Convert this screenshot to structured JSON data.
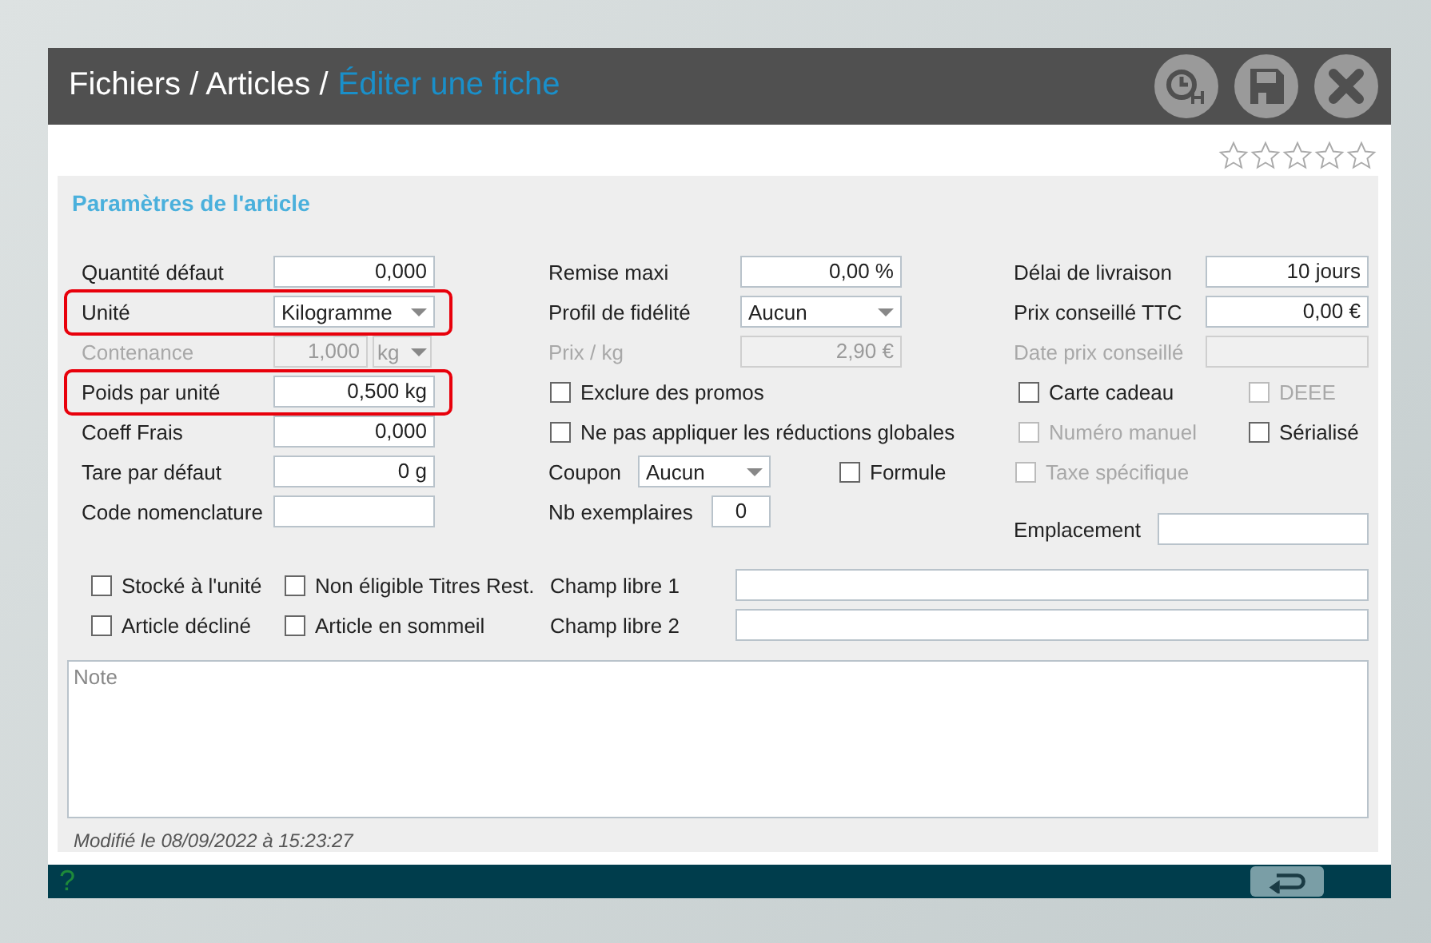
{
  "header": {
    "path": "Fichiers / Articles /",
    "current": "Éditer une fiche"
  },
  "stars": 0,
  "panel_title": "Paramètres de l'article",
  "columns": [
    {
      "rows": [
        {
          "cells": [
            {
              "kind": "field",
              "label": "Quantité défaut",
              "value": "0,000"
            }
          ]
        },
        {
          "cells": [
            {
              "kind": "select",
              "label": "Unité",
              "value": "Kilogramme",
              "highlighted": true
            }
          ]
        },
        {
          "cells": [
            {
              "kind": "field-unit",
              "label": "Contenance",
              "value": "1,000",
              "unit": "kg",
              "disabled": true
            }
          ]
        },
        {
          "cells": [
            {
              "kind": "field",
              "label": "Poids par unité",
              "value": "0,500 kg",
              "highlighted": true
            }
          ]
        },
        {
          "cells": [
            {
              "kind": "field",
              "label": "Coeff Frais",
              "value": "0,000"
            }
          ]
        },
        {
          "cells": [
            {
              "kind": "field",
              "label": "Tare par défaut",
              "value": "0 g"
            }
          ]
        },
        {
          "cells": [
            {
              "kind": "field",
              "label": "Code nomenclature"
            }
          ]
        }
      ]
    },
    {
      "rows": [
        {
          "cells": [
            {
              "kind": "field",
              "label": "Remise maxi",
              "value": "0,00 %"
            }
          ]
        },
        {
          "cells": [
            {
              "kind": "select",
              "label": "Profil de fidélité",
              "value": "Aucun"
            }
          ]
        },
        {
          "cells": [
            {
              "kind": "field",
              "label": "Prix / kg",
              "value": "2,90 €",
              "disabled": true
            }
          ]
        },
        {
          "cells": [
            {
              "kind": "checkbox",
              "label": "Exclure des promos",
              "checked": false
            }
          ]
        },
        {
          "cells": [
            {
              "kind": "checkbox",
              "label": "Ne pas appliquer les réductions globales",
              "checked": false
            }
          ]
        },
        {
          "cells": [
            {
              "kind": "short-select",
              "label": "Coupon",
              "value": "Aucun"
            },
            {
              "kind": "checkbox",
              "label": "Formule",
              "checked": false
            }
          ]
        },
        {
          "cells": [
            {
              "kind": "short-field",
              "label": "Nb exemplaires",
              "value": "0"
            }
          ]
        }
      ]
    },
    {
      "rows": [
        {
          "cells": [
            {
              "kind": "field",
              "label": "Délai de livraison",
              "value": "10 jours"
            }
          ]
        },
        {
          "cells": [
            {
              "kind": "field",
              "label": "Prix conseillé TTC",
              "value": "0,00 €"
            }
          ]
        },
        {
          "cells": [
            {
              "kind": "field",
              "label": "Date prix conseillé",
              "disabled": true
            }
          ]
        },
        {
          "cells": [
            {
              "kind": "checkbox",
              "label": "Carte cadeau",
              "checked": false
            },
            {
              "kind": "checkbox",
              "label": "DEEE",
              "checked": false,
              "disabled": true
            }
          ]
        },
        {
          "cells": [
            {
              "kind": "checkbox",
              "label": "Numéro manuel",
              "checked": false,
              "disabled": true
            },
            {
              "kind": "checkbox",
              "label": "Sérialisé",
              "checked": false
            }
          ]
        },
        {
          "cells": [
            {
              "kind": "checkbox",
              "label": "Taxe spécifique",
              "checked": false,
              "disabled": true
            }
          ]
        },
        {
          "cells": [
            {
              "kind": "field",
              "label": "Emplacement"
            }
          ]
        }
      ]
    }
  ],
  "bottom_rows": [
    {
      "cells": [
        {
          "kind": "checkbox",
          "label": "Stocké à l'unité",
          "checked": false
        },
        {
          "kind": "checkbox",
          "label": "Non éligible Titres Rest.",
          "checked": false
        },
        {
          "kind": "field",
          "label": "Champ libre 1"
        }
      ]
    },
    {
      "cells": [
        {
          "kind": "checkbox",
          "label": "Article décliné",
          "checked": false
        },
        {
          "kind": "checkbox",
          "label": "Article en sommeil",
          "checked": false
        },
        {
          "kind": "field",
          "label": "Champ libre 2"
        }
      ]
    }
  ],
  "note": {
    "placeholder": "Note"
  },
  "modified": "Modifié le 08/09/2022 à 15:23:27",
  "footer": {
    "help": "?"
  }
}
